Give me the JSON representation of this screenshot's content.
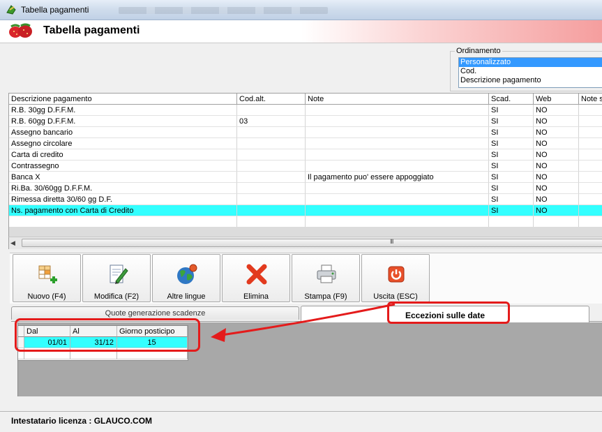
{
  "window": {
    "title": "Tabella pagamenti"
  },
  "header": {
    "title": "Tabella pagamenti"
  },
  "ordinamento": {
    "label": "Ordinamento",
    "options": [
      "Personalizzato",
      "Cod.",
      "Descrizione pagamento"
    ],
    "selected_index": 0
  },
  "grid": {
    "headers": [
      "Descrizione pagamento",
      "Cod.alt.",
      "Note",
      "Scad.",
      "Web",
      "Note s"
    ],
    "rows": [
      [
        "R.B. 30gg D.F.F.M.",
        "",
        "",
        "SI",
        "NO",
        ""
      ],
      [
        "R.B. 60gg D.F.F.M.",
        "03",
        "",
        "SI",
        "NO",
        ""
      ],
      [
        "Assegno bancario",
        "",
        "",
        "SI",
        "NO",
        ""
      ],
      [
        "Assegno circolare",
        "",
        "",
        "SI",
        "NO",
        ""
      ],
      [
        "Carta di credito",
        "",
        "",
        "SI",
        "NO",
        ""
      ],
      [
        "Contrassegno",
        "",
        "",
        "SI",
        "NO",
        ""
      ],
      [
        "Banca X",
        "",
        "Il pagamento puo' essere appoggiato",
        "SI",
        "NO",
        ""
      ],
      [
        "Ri.Ba. 30/60gg D.F.F.M.",
        "",
        "",
        "SI",
        "NO",
        ""
      ],
      [
        "Rimessa diretta 30/60 gg D.F.",
        "",
        "",
        "SI",
        "NO",
        ""
      ],
      [
        "Ns. pagamento con Carta di Credito",
        "",
        "",
        "SI",
        "NO",
        ""
      ]
    ],
    "highlighted_row": 9
  },
  "scrollbar": {
    "grip": "III"
  },
  "toolbar": {
    "nuovo": "Nuovo (F4)",
    "modifica": "Modifica (F2)",
    "altre_lingue": "Altre lingue",
    "elimina": "Elimina",
    "stampa": "Stampa (F9)",
    "uscita": "Uscita (ESC)"
  },
  "tabs": {
    "tab1": "Quote generazione scadenze",
    "tab2": "Eccezioni sulle date"
  },
  "subgrid": {
    "headers": [
      "Dal",
      "Al",
      "Giorno posticipo"
    ],
    "rows": [
      [
        "01/01",
        "31/12",
        "15"
      ]
    ]
  },
  "status": {
    "text": "Intestatario licenza : GLAUCO.COM"
  },
  "colors": {
    "highlight": "#33ffff",
    "selection": "#3399ff",
    "annotation": "#e41b1b"
  }
}
